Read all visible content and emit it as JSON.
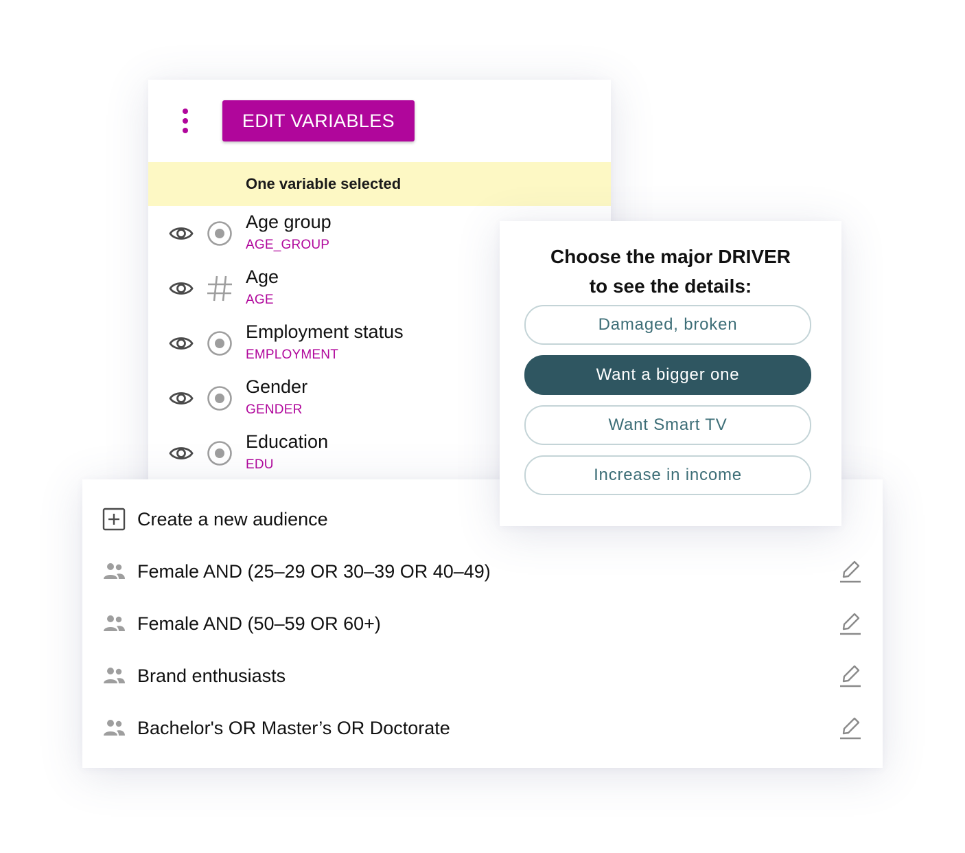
{
  "variables_panel": {
    "edit_button": "EDIT VARIABLES",
    "selection_status": "One variable selected",
    "variables": [
      {
        "label": "Age group",
        "code": "AGE_GROUP",
        "type_icon": "radio-icon"
      },
      {
        "label": "Age",
        "code": "AGE",
        "type_icon": "hash-icon"
      },
      {
        "label": "Employment status",
        "code": "EMPLOYMENT",
        "type_icon": "radio-icon"
      },
      {
        "label": "Gender",
        "code": "GENDER",
        "type_icon": "radio-icon"
      },
      {
        "label": "Education",
        "code": "EDU",
        "type_icon": "radio-icon"
      }
    ]
  },
  "driver_panel": {
    "title_line1": "Choose the major DRIVER",
    "title_line2": "to see the details:",
    "options": [
      {
        "label": "Damaged, broken",
        "selected": false
      },
      {
        "label": "Want a bigger one",
        "selected": true
      },
      {
        "label": "Want Smart TV",
        "selected": false
      },
      {
        "label": "Increase in income",
        "selected": false
      }
    ]
  },
  "audience_panel": {
    "create_label": "Create a new audience",
    "audiences": [
      {
        "label": "Female AND (25–29 OR 30–39 OR 40–49)"
      },
      {
        "label": "Female AND (50–59 OR 60+)"
      },
      {
        "label": "Brand enthusiasts"
      },
      {
        "label": "Bachelor's OR Master’s OR Doctorate"
      }
    ]
  },
  "colors": {
    "accent": "#b0069b",
    "selection_bg": "#fdf8c4",
    "driver_selected": "#2f5661",
    "driver_text": "#3d6e77",
    "icon_gray": "#9e9e9e"
  }
}
